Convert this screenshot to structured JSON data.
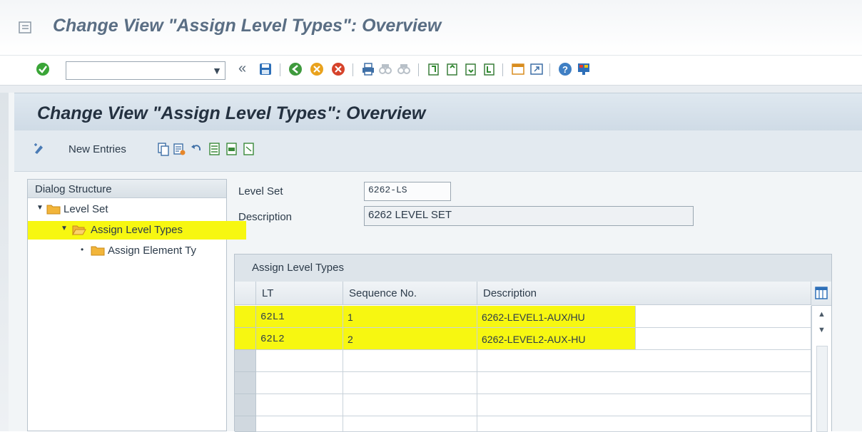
{
  "window": {
    "title": "Change View \"Assign Level Types\": Overview"
  },
  "toolbar": {
    "command_field_value": "",
    "icons": [
      "enter-icon",
      "dropdown-icon",
      "back-double-arrow-icon",
      "save-icon",
      "back-icon",
      "exit-icon",
      "cancel-icon",
      "print-icon",
      "find-icon",
      "find-next-icon",
      "first-page-icon",
      "previous-page-icon",
      "next-page-icon",
      "last-page-icon",
      "create-session-icon",
      "shortcut-icon",
      "help-icon",
      "customize-layout-icon"
    ],
    "back_glyph": "«"
  },
  "page": {
    "title": "Change View \"Assign Level Types\": Overview"
  },
  "app_toolbar": {
    "new_entries_label": "New Entries"
  },
  "dialog_structure": {
    "header": "Dialog Structure",
    "items": [
      {
        "label": "Level Set",
        "expanded": true
      },
      {
        "label": "Assign Level Types",
        "expanded": true,
        "selected": true
      },
      {
        "label": "Assign Element Ty",
        "expanded": false
      }
    ]
  },
  "fields": {
    "level_set": {
      "label": "Level Set",
      "value": "6262-LS"
    },
    "description": {
      "label": "Description",
      "value": "6262 LEVEL SET"
    }
  },
  "table": {
    "title": "Assign Level Types",
    "columns": [
      "LT",
      "Sequence No.",
      "Description"
    ],
    "rows": [
      {
        "lt": "62L1",
        "seq": "1",
        "description": "6262-LEVEL1-AUX/HU"
      },
      {
        "lt": "62L2",
        "seq": "2",
        "description": "6262-LEVEL2-AUX-HU"
      },
      {
        "lt": "",
        "seq": "",
        "description": ""
      },
      {
        "lt": "",
        "seq": "",
        "description": ""
      },
      {
        "lt": "",
        "seq": "",
        "description": ""
      },
      {
        "lt": "",
        "seq": "",
        "description": ""
      }
    ]
  },
  "colors": {
    "highlight": "#f7f711",
    "header_bg": "#cfdbe6",
    "title_grey": "#5a6e84"
  }
}
